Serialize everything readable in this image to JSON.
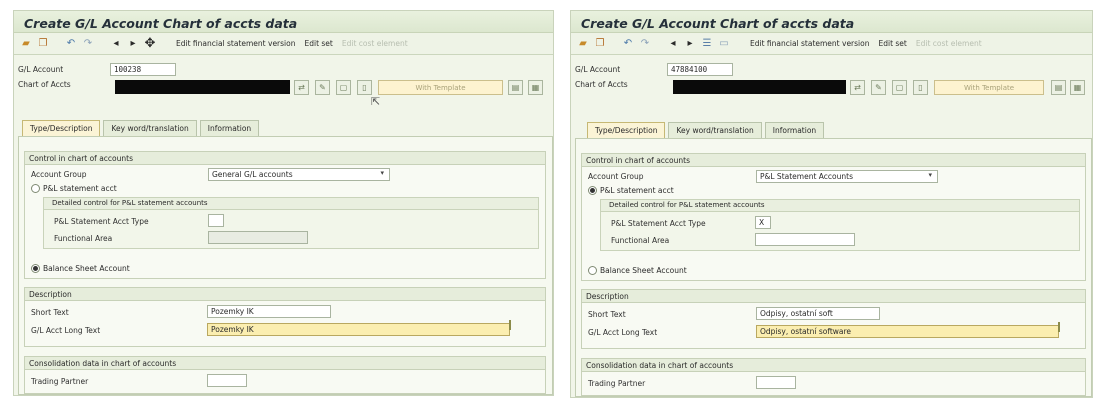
{
  "left": {
    "title": "Create G/L Account Chart of accts data",
    "toolbar": {
      "icons": [
        "folder-icon",
        "copy-icon",
        "undo-icon",
        "redo-icon",
        "prev-icon",
        "next-icon",
        "move-icon"
      ],
      "items": [
        "Edit financial statement version",
        "Edit set",
        "Edit cost element"
      ]
    },
    "gl_account_label": "G/L Account",
    "gl_account_value": "100238",
    "chart_of_accts_label": "Chart of Accts",
    "with_template": "With Template",
    "tabs": [
      "Type/Description",
      "Key word/translation",
      "Information"
    ],
    "control_title": "Control in chart of accounts",
    "account_group_label": "Account Group",
    "account_group_value": "General G/L accounts",
    "pl_label": "P&L statement acct",
    "detailed_title": "Detailed control for P&L statement accounts",
    "pl_type_label": "P&L Statement Acct Type",
    "pl_type_value": "",
    "functional_area_label": "Functional Area",
    "balance_label": "Balance Sheet Account",
    "description_title": "Description",
    "short_text_label": "Short Text",
    "short_text_value": "Pozemky IK",
    "long_text_label": "G/L Acct Long Text",
    "long_text_value": "Pozemky IK",
    "consolidation_title": "Consolidation data in chart of accounts",
    "trading_partner_label": "Trading Partner"
  },
  "right": {
    "title": "Create G/L Account Chart of accts data",
    "toolbar": {
      "icons": [
        "folder-icon",
        "copy-icon",
        "undo-icon",
        "redo-icon",
        "prev-icon",
        "next-icon",
        "tree-icon",
        "display-icon"
      ],
      "items": [
        "Edit financial statement version",
        "Edit set",
        "Edit cost element"
      ]
    },
    "gl_account_label": "G/L Account",
    "gl_account_value": "47884100",
    "chart_of_accts_label": "Chart of Accts",
    "with_template": "With Template",
    "tabs": [
      "Type/Description",
      "Key word/translation",
      "Information"
    ],
    "control_title": "Control in chart of accounts",
    "account_group_label": "Account Group",
    "account_group_value": "P&L Statement Accounts",
    "pl_label": "P&L statement acct",
    "detailed_title": "Detailed control for P&L statement accounts",
    "pl_type_label": "P&L Statement Acct Type",
    "pl_type_value": "X",
    "functional_area_label": "Functional Area",
    "balance_label": "Balance Sheet Account",
    "description_title": "Description",
    "short_text_label": "Short Text",
    "short_text_value": "Odpisy, ostatní soft",
    "long_text_label": "G/L Acct Long Text",
    "long_text_value": "Odpisy, ostatní software",
    "consolidation_title": "Consolidation data in chart of accounts",
    "trading_partner_label": "Trading Partner"
  },
  "colors": {
    "panel_bg": "#f1f5e9",
    "active_tab": "#fbf4d6",
    "long_text_highlight": "#fbeeb0"
  }
}
